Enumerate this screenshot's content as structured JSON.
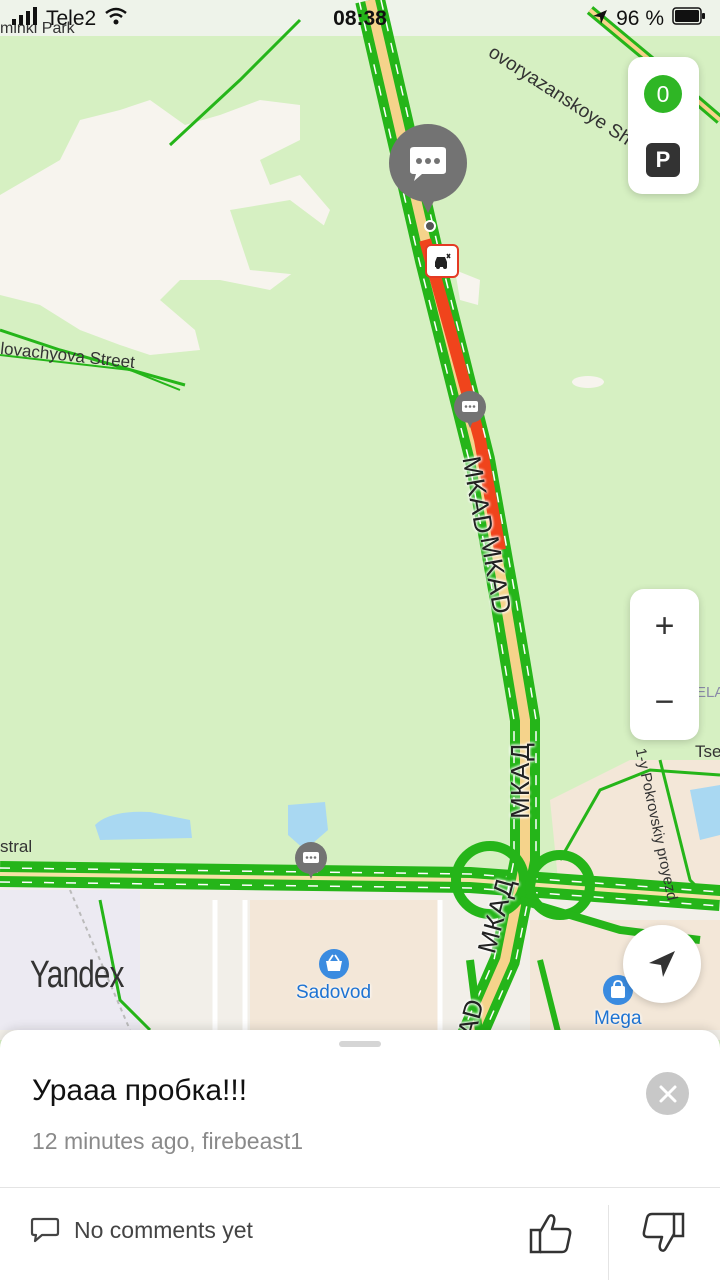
{
  "status_bar": {
    "carrier": "Tele2",
    "time": "08:38",
    "battery": "96 %"
  },
  "map": {
    "labels": {
      "park": "minki Park",
      "street": "lovachyova Street",
      "highway": "ovoryazanskoye Shosse",
      "astral": "stral",
      "pokrovsky": "1-y Pokrovskiy proyezd",
      "tse": "Tse",
      "bela": "BELA",
      "mkad_1": "MKAD",
      "mkad_2": "MKAD",
      "mkad_3": "МКАД",
      "mkad_4": "МКАД",
      "mkad_5": "AD"
    },
    "pois": {
      "sadovod": "Sadovod",
      "mega": "Mega"
    },
    "logo": "Yandex",
    "controls": {
      "traffic_level": "0",
      "parking_label": "P",
      "zoom_in": "+",
      "zoom_out": "−"
    },
    "colors": {
      "free_flow": "#25b519",
      "heavy_traffic": "#f0441c",
      "park_green": "#d6f0c2"
    }
  },
  "sheet": {
    "title": "Урааа пробка!!!",
    "meta": "12 minutes ago, firebeast1",
    "comments_label": "No comments yet"
  }
}
